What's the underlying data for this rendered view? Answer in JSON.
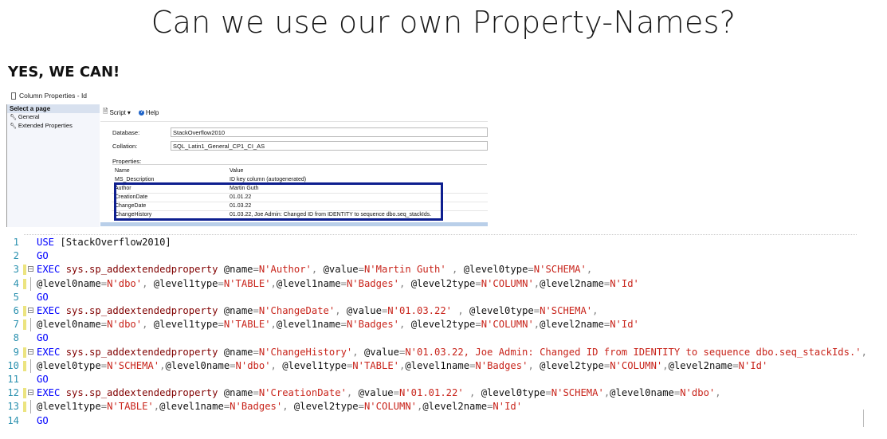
{
  "slide": {
    "title": "Can we use our own Property-Names?",
    "subtitle": "YES, WE CAN!"
  },
  "dialog": {
    "title": "Column Properties - Id",
    "left_header": "Select a page",
    "pages": [
      "General",
      "Extended Properties"
    ],
    "toolbar": {
      "script": "Script",
      "help": "Help"
    },
    "database_label": "Database:",
    "database_value": "StackOverflow2010",
    "collation_label": "Collation:",
    "collation_value": "SQL_Latin1_General_CP1_CI_AS",
    "properties_label": "Properties:",
    "grid_headers": {
      "name": "Name",
      "value": "Value"
    },
    "rows": [
      {
        "name": "MS_Description",
        "value": "ID key column (autogenerated)"
      },
      {
        "name": "Author",
        "value": "Martin Guth"
      },
      {
        "name": "CreationDate",
        "value": "01.01.22"
      },
      {
        "name": "ChangeDate",
        "value": "01.03.22"
      },
      {
        "name": "ChangeHistory",
        "value": "01.03.22, Joe Admin: Changed ID from IDENTITY to sequence dbo.seq_stackIds."
      }
    ],
    "highlight_color": "#0e1f8f"
  },
  "editor": {
    "colors": {
      "keyword": "#0000ff",
      "system_proc": "#800000",
      "string": "#c8241b",
      "operator": "#808080",
      "line_number": "#2b91af"
    },
    "lines": [
      {
        "n": "1",
        "tokens": [
          [
            "kw",
            "USE "
          ],
          [
            "bk",
            "[StackOverflow2010]"
          ]
        ]
      },
      {
        "n": "2",
        "tokens": [
          [
            "kw",
            "GO"
          ]
        ]
      },
      {
        "n": "3",
        "fold": true,
        "tokens": [
          [
            "kw",
            "EXEC "
          ],
          [
            "sp",
            "sys.sp_addextendedproperty "
          ],
          [
            "bk",
            "@name"
          ],
          [
            "gr",
            "="
          ],
          [
            "str",
            "N'Author'"
          ],
          [
            "gr",
            ", "
          ],
          [
            "bk",
            "@value"
          ],
          [
            "gr",
            "="
          ],
          [
            "str",
            "N'Martin Guth'"
          ],
          [
            "gr",
            " , "
          ],
          [
            "bk",
            "@level0type"
          ],
          [
            "gr",
            "="
          ],
          [
            "str",
            "N'SCHEMA'"
          ],
          [
            "gr",
            ","
          ]
        ]
      },
      {
        "n": "4",
        "cont": true,
        "tokens": [
          [
            "bk",
            "@level0name"
          ],
          [
            "gr",
            "="
          ],
          [
            "str",
            "N'dbo'"
          ],
          [
            "gr",
            ", "
          ],
          [
            "bk",
            "@level1type"
          ],
          [
            "gr",
            "="
          ],
          [
            "str",
            "N'TABLE'"
          ],
          [
            "gr",
            ","
          ],
          [
            "bk",
            "@level1name"
          ],
          [
            "gr",
            "="
          ],
          [
            "str",
            "N'Badges'"
          ],
          [
            "gr",
            ", "
          ],
          [
            "bk",
            "@level2type"
          ],
          [
            "gr",
            "="
          ],
          [
            "str",
            "N'COLUMN'"
          ],
          [
            "gr",
            ","
          ],
          [
            "bk",
            "@level2name"
          ],
          [
            "gr",
            "="
          ],
          [
            "str",
            "N'Id'"
          ]
        ]
      },
      {
        "n": "5",
        "tokens": [
          [
            "kw",
            "GO"
          ]
        ]
      },
      {
        "n": "6",
        "fold": true,
        "tokens": [
          [
            "kw",
            "EXEC "
          ],
          [
            "sp",
            "sys.sp_addextendedproperty "
          ],
          [
            "bk",
            "@name"
          ],
          [
            "gr",
            "="
          ],
          [
            "str",
            "N'ChangeDate'"
          ],
          [
            "gr",
            ", "
          ],
          [
            "bk",
            "@value"
          ],
          [
            "gr",
            "="
          ],
          [
            "str",
            "N'01.03.22'"
          ],
          [
            "gr",
            " , "
          ],
          [
            "bk",
            "@level0type"
          ],
          [
            "gr",
            "="
          ],
          [
            "str",
            "N'SCHEMA'"
          ],
          [
            "gr",
            ","
          ]
        ]
      },
      {
        "n": "7",
        "cont": true,
        "tokens": [
          [
            "bk",
            "@level0name"
          ],
          [
            "gr",
            "="
          ],
          [
            "str",
            "N'dbo'"
          ],
          [
            "gr",
            ", "
          ],
          [
            "bk",
            "@level1type"
          ],
          [
            "gr",
            "="
          ],
          [
            "str",
            "N'TABLE'"
          ],
          [
            "gr",
            ","
          ],
          [
            "bk",
            "@level1name"
          ],
          [
            "gr",
            "="
          ],
          [
            "str",
            "N'Badges'"
          ],
          [
            "gr",
            ", "
          ],
          [
            "bk",
            "@level2type"
          ],
          [
            "gr",
            "="
          ],
          [
            "str",
            "N'COLUMN'"
          ],
          [
            "gr",
            ","
          ],
          [
            "bk",
            "@level2name"
          ],
          [
            "gr",
            "="
          ],
          [
            "str",
            "N'Id'"
          ]
        ]
      },
      {
        "n": "8",
        "tokens": [
          [
            "kw",
            "GO"
          ]
        ]
      },
      {
        "n": "9",
        "fold": true,
        "tokens": [
          [
            "kw",
            "EXEC "
          ],
          [
            "sp",
            "sys.sp_addextendedproperty "
          ],
          [
            "bk",
            "@name"
          ],
          [
            "gr",
            "="
          ],
          [
            "str",
            "N'ChangeHistory'"
          ],
          [
            "gr",
            ", "
          ],
          [
            "bk",
            "@value"
          ],
          [
            "gr",
            "="
          ],
          [
            "str",
            "N'01.03.22, Joe Admin: Changed ID from IDENTITY to sequence dbo.seq_stackIds.'"
          ],
          [
            "gr",
            ","
          ]
        ]
      },
      {
        "n": "10",
        "cont": true,
        "tokens": [
          [
            "bk",
            "@level0type"
          ],
          [
            "gr",
            "="
          ],
          [
            "str",
            "N'SCHEMA'"
          ],
          [
            "gr",
            ","
          ],
          [
            "bk",
            "@level0name"
          ],
          [
            "gr",
            "="
          ],
          [
            "str",
            "N'dbo'"
          ],
          [
            "gr",
            ", "
          ],
          [
            "bk",
            "@level1type"
          ],
          [
            "gr",
            "="
          ],
          [
            "str",
            "N'TABLE'"
          ],
          [
            "gr",
            ","
          ],
          [
            "bk",
            "@level1name"
          ],
          [
            "gr",
            "="
          ],
          [
            "str",
            "N'Badges'"
          ],
          [
            "gr",
            ", "
          ],
          [
            "bk",
            "@level2type"
          ],
          [
            "gr",
            "="
          ],
          [
            "str",
            "N'COLUMN'"
          ],
          [
            "gr",
            ","
          ],
          [
            "bk",
            "@level2name"
          ],
          [
            "gr",
            "="
          ],
          [
            "str",
            "N'Id'"
          ]
        ]
      },
      {
        "n": "11",
        "tokens": [
          [
            "kw",
            "GO"
          ]
        ]
      },
      {
        "n": "12",
        "fold": true,
        "tokens": [
          [
            "kw",
            "EXEC "
          ],
          [
            "sp",
            "sys.sp_addextendedproperty "
          ],
          [
            "bk",
            "@name"
          ],
          [
            "gr",
            "="
          ],
          [
            "str",
            "N'CreationDate'"
          ],
          [
            "gr",
            ", "
          ],
          [
            "bk",
            "@value"
          ],
          [
            "gr",
            "="
          ],
          [
            "str",
            "N'01.01.22'"
          ],
          [
            "gr",
            " , "
          ],
          [
            "bk",
            "@level0type"
          ],
          [
            "gr",
            "="
          ],
          [
            "str",
            "N'SCHEMA'"
          ],
          [
            "gr",
            ","
          ],
          [
            "bk",
            "@level0name"
          ],
          [
            "gr",
            "="
          ],
          [
            "str",
            "N'dbo'"
          ],
          [
            "gr",
            ","
          ]
        ]
      },
      {
        "n": "13",
        "cont": true,
        "tokens": [
          [
            "bk",
            "@level1type"
          ],
          [
            "gr",
            "="
          ],
          [
            "str",
            "N'TABLE'"
          ],
          [
            "gr",
            ","
          ],
          [
            "bk",
            "@level1name"
          ],
          [
            "gr",
            "="
          ],
          [
            "str",
            "N'Badges'"
          ],
          [
            "gr",
            ", "
          ],
          [
            "bk",
            "@level2type"
          ],
          [
            "gr",
            "="
          ],
          [
            "str",
            "N'COLUMN'"
          ],
          [
            "gr",
            ","
          ],
          [
            "bk",
            "@level2name"
          ],
          [
            "gr",
            "="
          ],
          [
            "str",
            "N'Id'"
          ]
        ]
      },
      {
        "n": "14",
        "tokens": [
          [
            "kw",
            "GO"
          ]
        ]
      }
    ]
  }
}
